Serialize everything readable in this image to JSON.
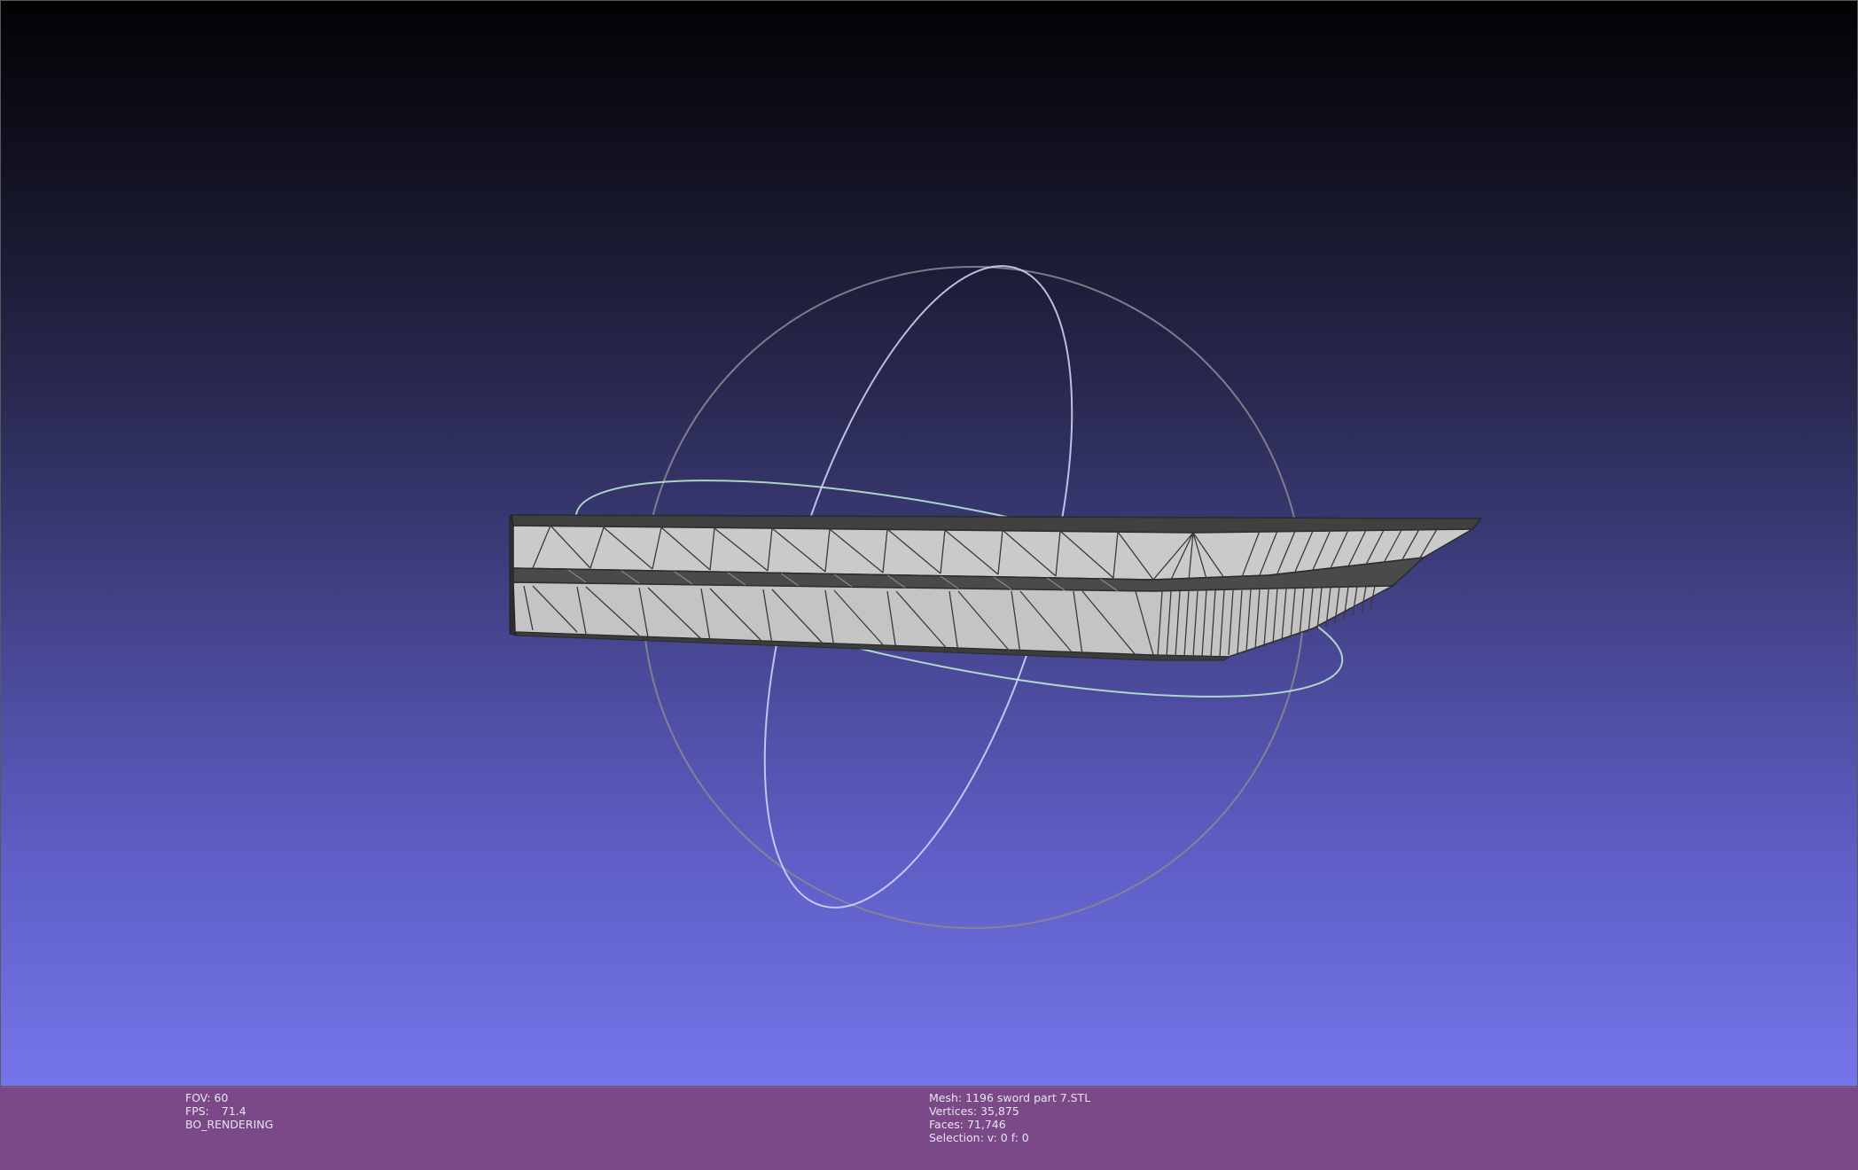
{
  "viewer": {
    "colors": {
      "background_top": "#020204",
      "background_bottom": "#7575ea",
      "statusbar": "#7b4888",
      "mesh_face": "#c8c8c8",
      "mesh_edge": "#3a3a3a",
      "trackball_outline": "#8a8a8a",
      "trackball_x": "#dfe8ff",
      "trackball_y": "#c8ffd8"
    }
  },
  "status": {
    "left": {
      "fov": "FOV: 60",
      "fps_label": "FPS:",
      "fps_value": "71.4",
      "mode": "BO_RENDERING"
    },
    "right": {
      "mesh": "Mesh: 1196 sword part 7.STL",
      "vertices": "Vertices: 35,875",
      "faces": "Faces: 71,746",
      "selection": "Selection: v: 0 f: 0"
    }
  }
}
